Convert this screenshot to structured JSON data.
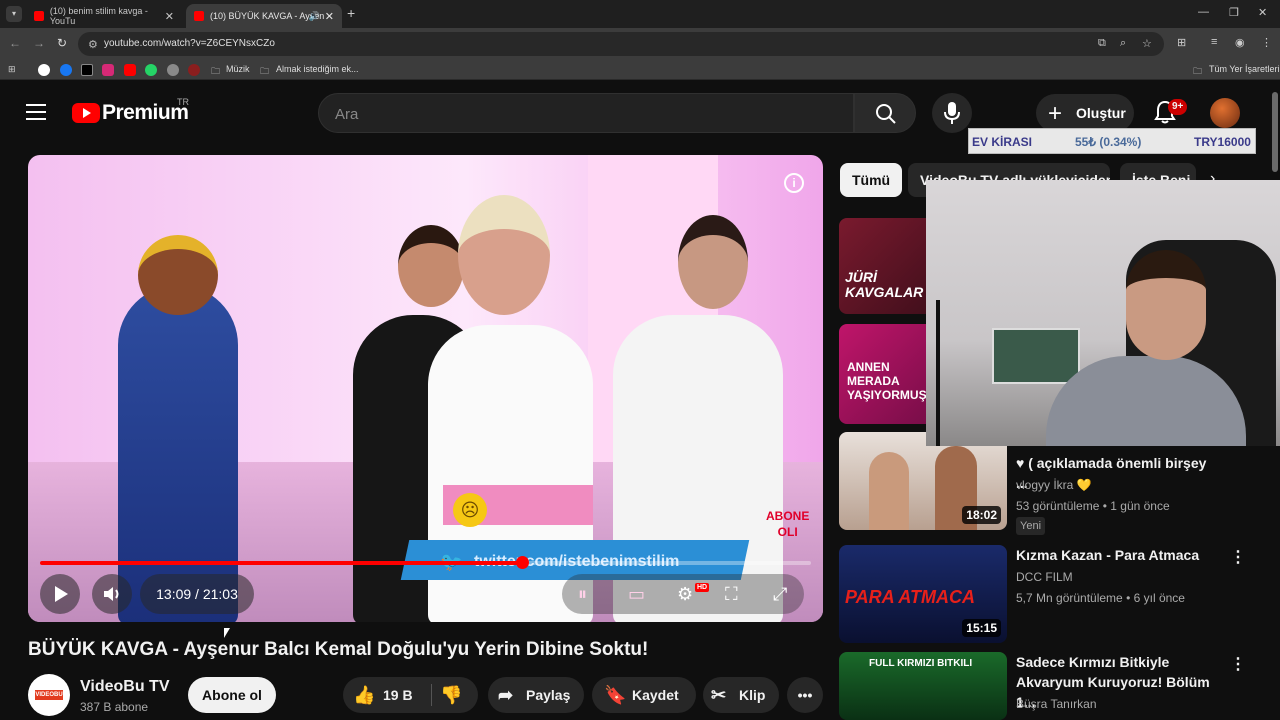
{
  "browser": {
    "tabs": [
      {
        "title": "(10) benim stilim kavga - YouTu",
        "active": false
      },
      {
        "title": "(10) BÜYÜK KAVGA - Ayşen",
        "active": true
      }
    ],
    "url": "youtube.com/watch?v=Z6CEYNsxCZo",
    "bookmarks": [
      {
        "label": "Müzik"
      },
      {
        "label": "Almak istediğim ek..."
      }
    ],
    "bookmarks_all": "Tüm Yer İşaretleri"
  },
  "header": {
    "logo_text": "Premium",
    "region": "TR",
    "search_placeholder": "Ara",
    "create_label": "Oluştur",
    "notification_badge": "9+"
  },
  "ticker": {
    "label": "EV KİRASI",
    "change": "55₺ (0.34%)",
    "value": "TRY16000"
  },
  "player": {
    "current_time": "13:09",
    "duration": "21:03",
    "time_display": "13:09 / 21:03",
    "progress_fraction": 0.625,
    "overlay_subscribe": [
      "ABONE",
      "OLI"
    ],
    "twitter_text": "twitter.com/istebenimstilim",
    "hd_label": "HD"
  },
  "video": {
    "title": "BÜYÜK KAVGA - Ayşenur Balcı Kemal Doğulu'yu Yerin Dibine Soktu!",
    "channel": "VideoBu TV",
    "subscribers": "387 B abone",
    "subscribe_label": "Abone ol",
    "likes": "19 B",
    "share_label": "Paylaş",
    "save_label": "Kaydet",
    "clip_label": "Klip",
    "channel_logo_text": "VIDEOBU TV"
  },
  "chips": [
    "Tümü",
    "VideoBu TV adlı yükleyiciden",
    "İste Beni"
  ],
  "recommendations": [
    {
      "thumb_text": "JÜRİ KAVGALAR",
      "title": "",
      "channel": "",
      "meta": "",
      "duration": ""
    },
    {
      "thumb_text": "ANNEN MERADA YAŞIYORMUŞ",
      "title": "",
      "channel": "",
      "meta": "",
      "duration": ""
    },
    {
      "thumb_text": "",
      "title": "♥ ( açıklamada önemli birşey ...",
      "channel": "vlogyy İkra 💛",
      "meta": "53 görüntüleme • 1 gün önce",
      "badge": "Yeni",
      "duration": "18:02"
    },
    {
      "thumb_text": "PARA ATMACA",
      "title": "Kızma Kazan - Para Atmaca",
      "channel": "DCC FILM",
      "meta": "5,7 Mn görüntüleme • 6 yıl önce",
      "duration": "15:15"
    },
    {
      "thumb_text": "FULL KIRMIZI BITKILI",
      "title": "Sadece Kırmızı Bitkiyle Akvaryum Kuruyoruz! Bölüm 1...",
      "channel": "Büşra Tanırkan",
      "meta": "",
      "duration": ""
    }
  ],
  "colors": {
    "accent": "#ff0000",
    "background": "#0f0f0f",
    "twitter": "#2b8fd6"
  }
}
